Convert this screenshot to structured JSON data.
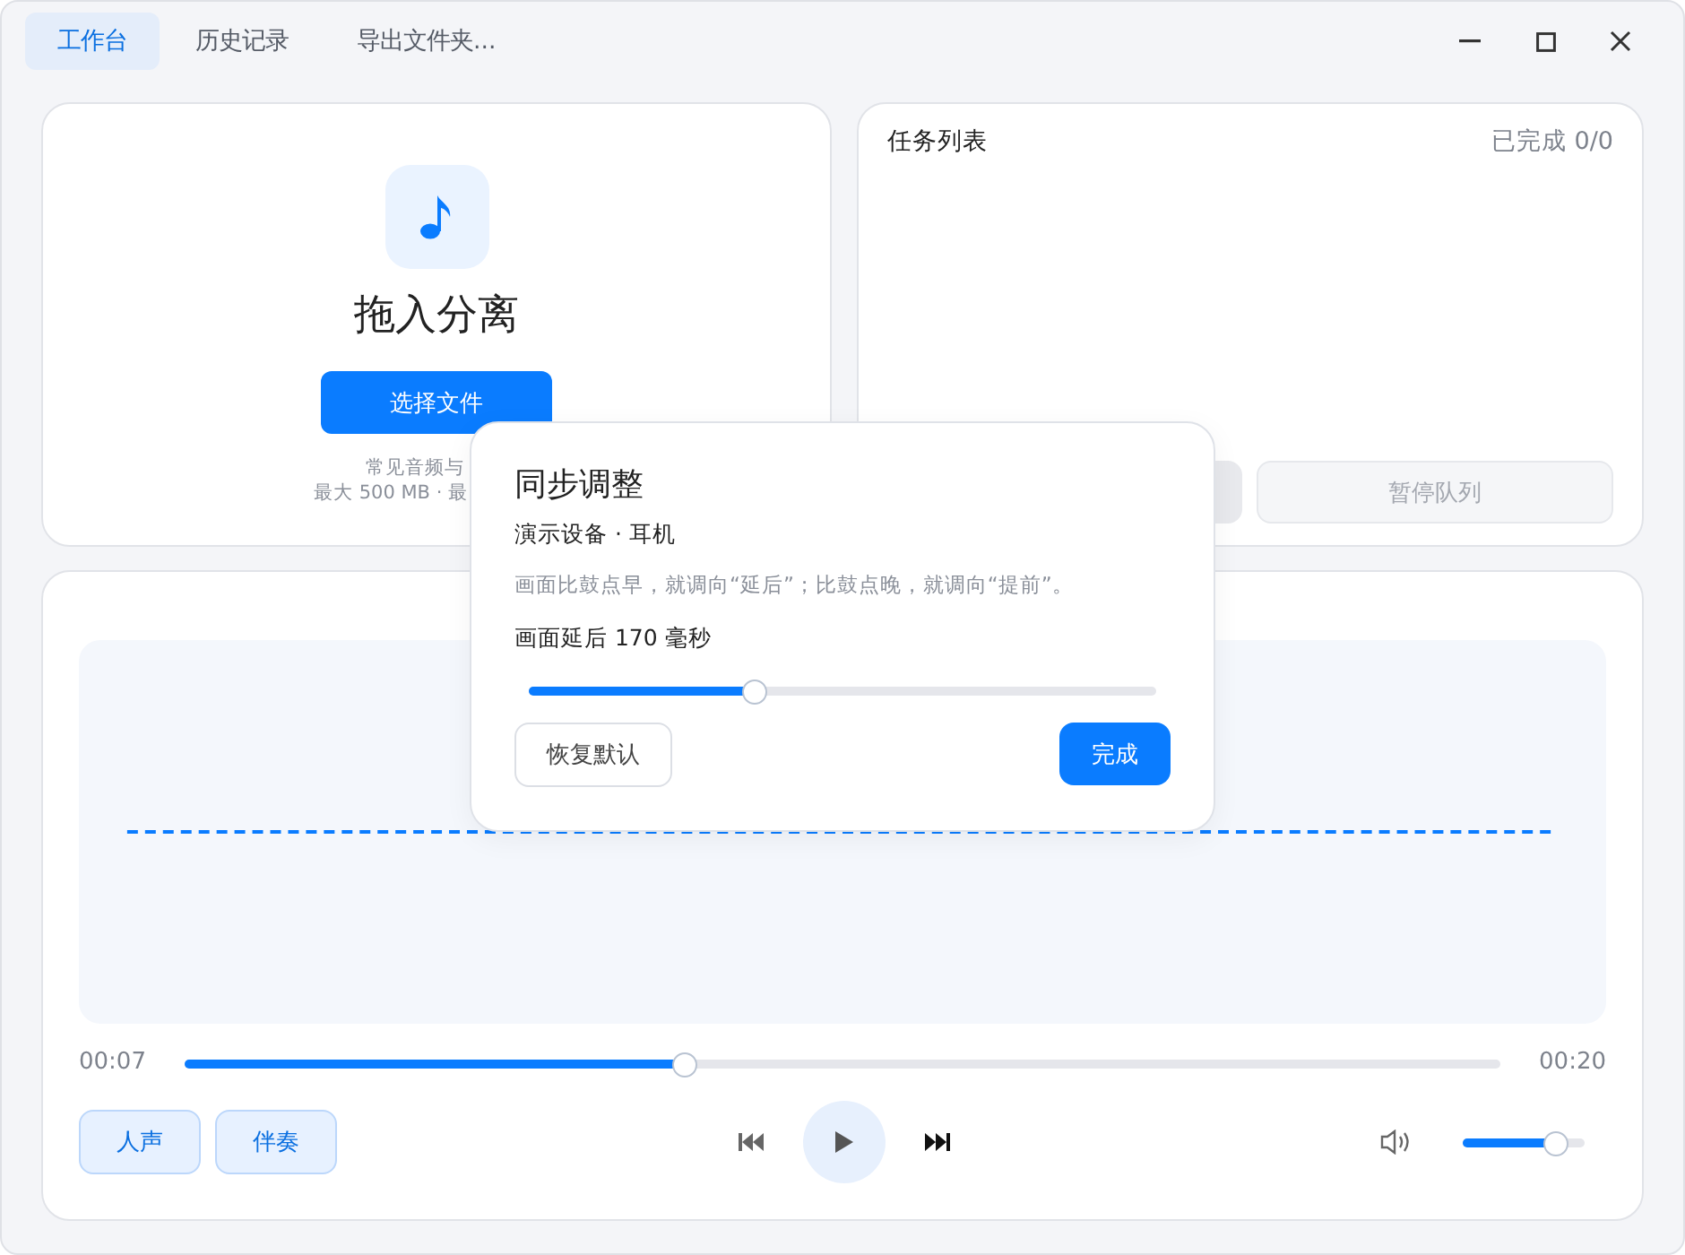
{
  "tabs": [
    {
      "label": "工作台",
      "selected": true
    },
    {
      "label": "历史记录",
      "selected": false
    },
    {
      "label": "导出文件夹...",
      "selected": false
    }
  ],
  "upload": {
    "title": "拖入分离",
    "button": "选择文件",
    "hint_lines": [
      "常见音频与",
      "最大 500 MB · 最"
    ]
  },
  "tasks": {
    "title": "任务列表",
    "count": "已完成 0/0",
    "buttons": [
      {
        "disabled": false
      },
      {
        "label": "暂停队列",
        "disabled": true
      }
    ]
  },
  "player": {
    "current": "00:07",
    "total": "00:20",
    "level": 0.38,
    "stems": [
      {
        "label": "人声",
        "on": true
      },
      {
        "label": "伴奏",
        "on": true
      }
    ],
    "volume": {
      "level": 0.76
    }
  },
  "dialog": {
    "title": "同步调整",
    "device": "演示设备 · 耳机",
    "hint": "画面比鼓点早，就调向“延后”；比鼓点晚，就调向“提前”。",
    "value": "画面延后 170 毫秒",
    "slider": {
      "level": 0.36
    },
    "reset": "恢复默认",
    "done": "完成"
  }
}
